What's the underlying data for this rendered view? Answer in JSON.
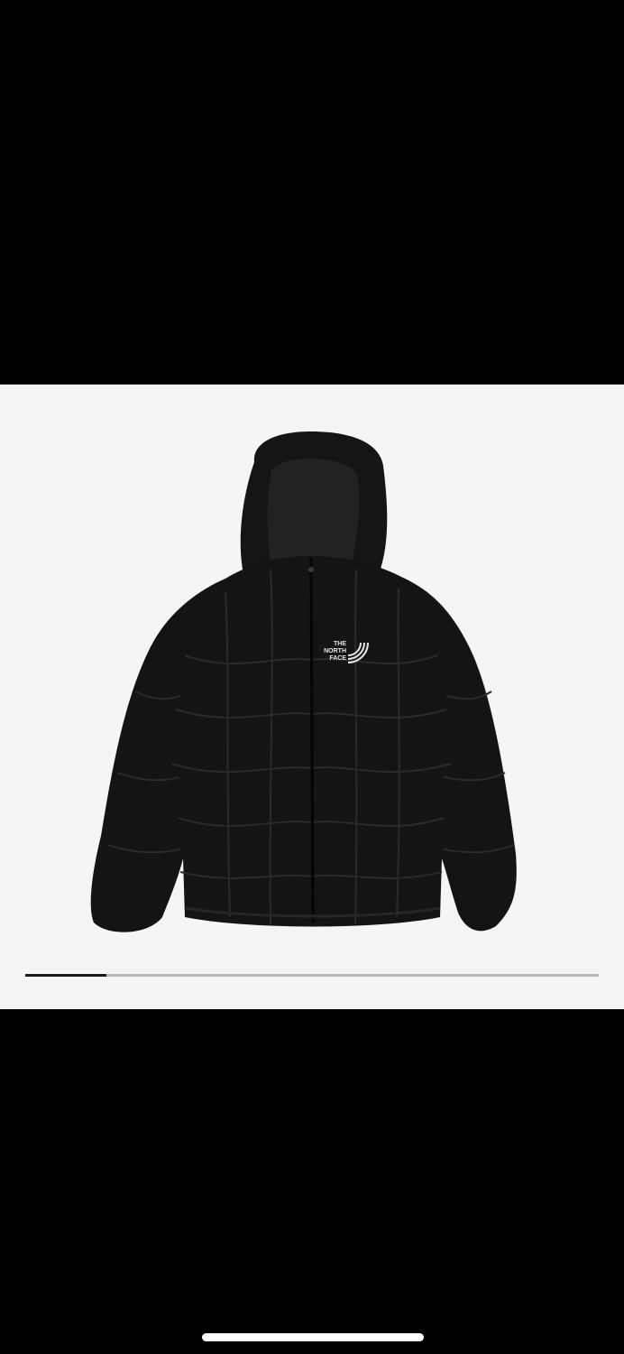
{
  "product": {
    "image_description_icon": "puffer-jacket-icon",
    "logo_text": "THE NORTH FACE",
    "colors": {
      "jacket": "#141414",
      "background": "#f5f5f5",
      "logo": "#e6e6e6"
    }
  },
  "carousel": {
    "progress": 0.142,
    "progress_color": "#1a1a1a",
    "track_color": "#b9b9b9"
  },
  "system": {
    "home_indicator_color": "#ffffff"
  }
}
